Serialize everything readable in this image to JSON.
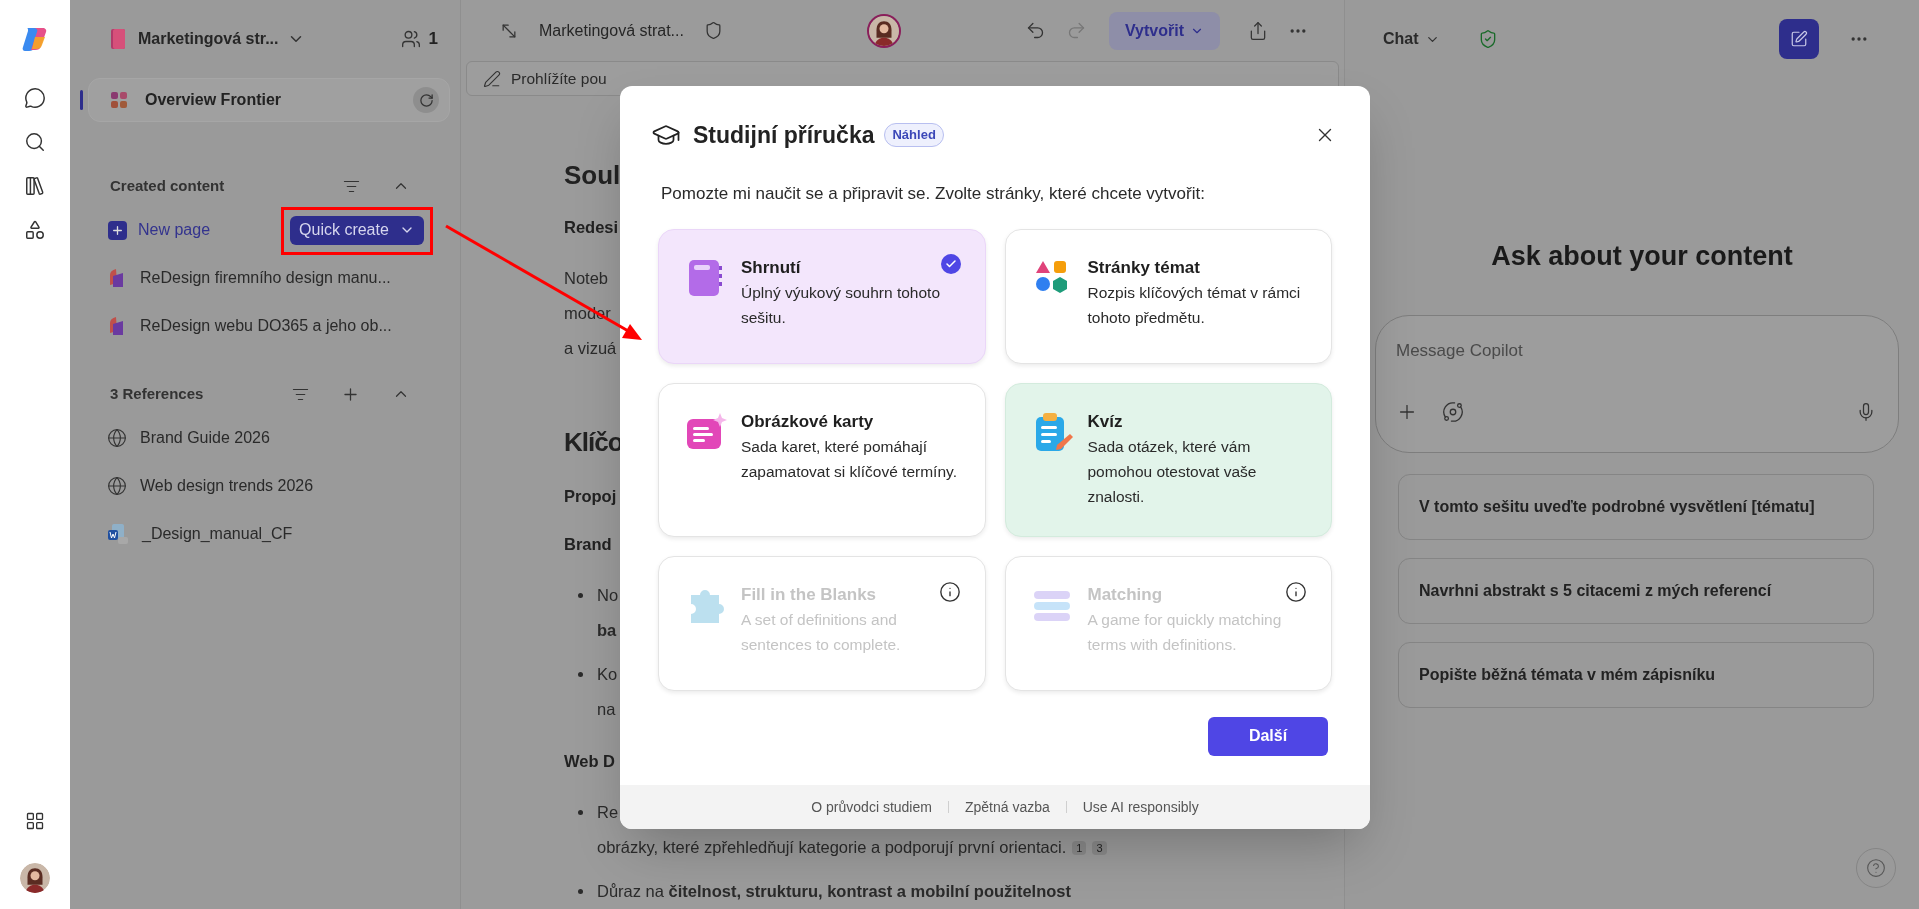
{
  "notebook": {
    "title": "Marketingová str...",
    "members": "1"
  },
  "overview": {
    "label": "Overview Frontier",
    "selected": true
  },
  "created_content": {
    "heading": "Created content",
    "new_page": "New page",
    "quick_create": "Quick create",
    "items": [
      "ReDesign firemního design manu...",
      "ReDesign webu DO365 a jeho ob..."
    ]
  },
  "references": {
    "heading": "3 References",
    "items": [
      {
        "label": "Brand Guide 2026",
        "kind": "web"
      },
      {
        "label": "Web design trends 2026",
        "kind": "web"
      },
      {
        "label": "_Design_manual_CF",
        "kind": "word"
      }
    ]
  },
  "doc_toolbar": {
    "title": "Marketingová strat...",
    "create": "Vytvořit"
  },
  "banner": {
    "text": "Prohlížíte pou"
  },
  "document": {
    "blocks": [
      {
        "kind": "h2",
        "text": "Soul"
      },
      {
        "kind": "bold",
        "text": "Redesi"
      },
      {
        "kind": "para",
        "text": "Noteb"
      },
      {
        "kind": "para",
        "text": "moder"
      },
      {
        "kind": "para",
        "text": "a vizuá"
      },
      {
        "kind": "h1",
        "text": "Klíčo"
      },
      {
        "kind": "bold",
        "text": "Propoj"
      },
      {
        "kind": "bold",
        "text": "Brand"
      },
      {
        "kind": "bullet",
        "text": "No"
      },
      {
        "kind": "cont",
        "text": "**ba**"
      },
      {
        "kind": "bullet",
        "text": "Ko"
      },
      {
        "kind": "cont",
        "text": "na"
      },
      {
        "kind": "bold",
        "text": "Web D"
      },
      {
        "kind": "bullet",
        "text": "Re"
      },
      {
        "kind": "cont",
        "text": "obrázky, které zpřehledňují kategorie a podporují první orientaci.",
        "citations": [
          "1",
          "3"
        ]
      },
      {
        "kind": "bullet",
        "text": "Důraz na **čitelnost, strukturu, kontrast a mobilní použitelnost**"
      }
    ]
  },
  "modal": {
    "title": "Studijní příručka",
    "badge": "Náhled",
    "intro": "Pomozte mi naučit se a připravit se. Zvolte stránky, které chcete vytvořit:",
    "options": [
      {
        "kind": "summary",
        "title": "Shrnutí",
        "description": "Úplný výukový souhrn tohoto sešitu.",
        "selected": true,
        "hovered": false,
        "disabled": false
      },
      {
        "kind": "topics",
        "title": "Stránky témat",
        "description": "Rozpis klíčových témat v rámci tohoto předmětu.",
        "selected": false,
        "hovered": false,
        "disabled": false
      },
      {
        "kind": "flashcards",
        "title": "Obrázkové karty",
        "description": "Sada karet, které pomáhají zapamatovat si klíčové termíny.",
        "selected": false,
        "hovered": false,
        "disabled": false
      },
      {
        "kind": "quiz",
        "title": "Kvíz",
        "description": "Sada otázek, které vám pomohou otestovat vaše znalosti.",
        "selected": false,
        "hovered": true,
        "disabled": false
      },
      {
        "kind": "blanks",
        "title": "Fill in the Blanks",
        "description": "A set of definitions and sentences to complete.",
        "selected": false,
        "hovered": false,
        "disabled": true
      },
      {
        "kind": "matching",
        "title": "Matching",
        "description": "A game for quickly matching terms with definitions.",
        "selected": false,
        "hovered": false,
        "disabled": true
      }
    ],
    "next": "Další",
    "footer_links": [
      "O průvodci studiem",
      "Zpětná vazba",
      "Use AI responsibly"
    ]
  },
  "chat": {
    "title": "Chat",
    "heading": "Ask about your content",
    "placeholder": "Message Copilot",
    "suggestions": [
      "V tomto sešitu uveďte podrobné vysvětlení [tématu]",
      "Navrhni abstrakt s 5 citacemi z mých referencí",
      "Popište běžná témata v mém zápisníku"
    ]
  }
}
